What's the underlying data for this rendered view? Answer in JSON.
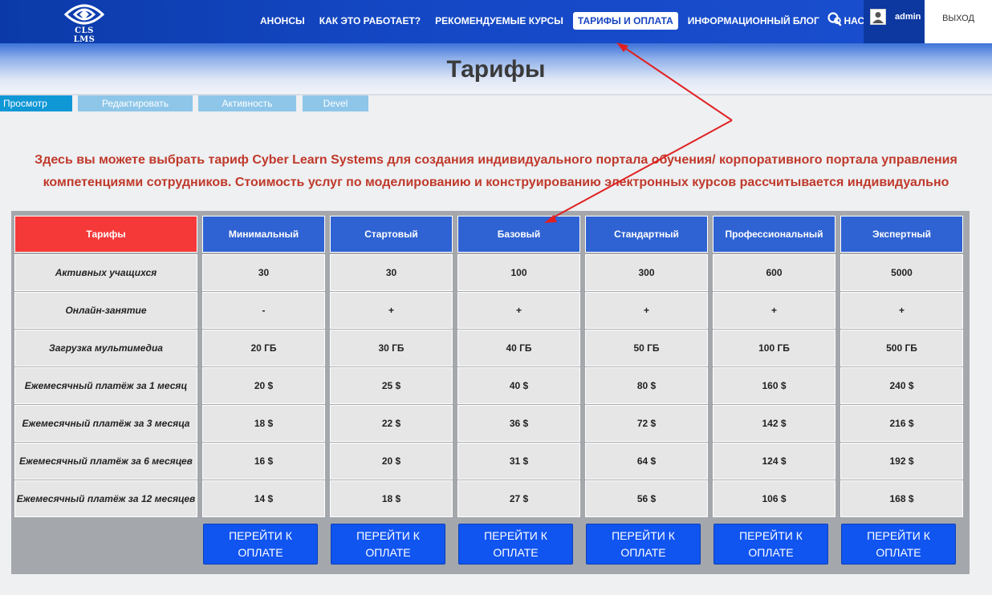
{
  "brand": {
    "logo_text": "CLS LMS"
  },
  "nav": {
    "items": [
      {
        "label": "АНОНСЫ"
      },
      {
        "label": "КАК ЭТО РАБОТАЕТ?"
      },
      {
        "label": "РЕКОМЕНДУЕМЫЕ КУРСЫ"
      },
      {
        "label": "ТАРИФЫ И ОПЛАТА",
        "active": true
      },
      {
        "label": "ИНФОРМАЦИОННЫЙ БЛОГ"
      },
      {
        "label": "О НАС"
      }
    ],
    "search_icon": "search-icon"
  },
  "user": {
    "name": "admin",
    "avatar_icon": "user-icon",
    "logout_label": "ВЫХОД"
  },
  "page": {
    "title": "Тарифы"
  },
  "tabs": [
    {
      "label": "Просмотр",
      "active": true
    },
    {
      "label": "Редактировать"
    },
    {
      "label": "Активность"
    },
    {
      "label": "Devel"
    }
  ],
  "intro": {
    "line1": "Здесь вы можете выбрать тариф  Cyber Learn Systems для создания индивидуального портала обучения/ корпоративного портала управления",
    "line2": "компетенциями сотрудников. Стоимость услуг по моделированию и конструированию электронных курсов рассчитывается индивидуально"
  },
  "pricing_table": {
    "corner_label": "Тарифы",
    "plans": [
      "Минимальный",
      "Стартовый",
      "Базовый",
      "Стандартный",
      "Профессиональный",
      "Экспертный"
    ],
    "rows": [
      {
        "label": "Активных учащихся",
        "values": [
          "30",
          "30",
          "100",
          "300",
          "600",
          "5000"
        ]
      },
      {
        "label": "Онлайн-занятие",
        "values": [
          "-",
          "+",
          "+",
          "+",
          "+",
          "+"
        ]
      },
      {
        "label": "Загрузка мультимедиа",
        "values": [
          "20 ГБ",
          "30 ГБ",
          "40 ГБ",
          "50 ГБ",
          "100 ГБ",
          "500 ГБ"
        ]
      },
      {
        "label": "Ежемесячный платёж за 1 месяц",
        "values": [
          "20 $",
          "25 $",
          "40 $",
          "80 $",
          "160 $",
          "240 $"
        ]
      },
      {
        "label": "Ежемесячный платёж за 3 месяца",
        "values": [
          "18 $",
          "22 $",
          "36 $",
          "72 $",
          "142 $",
          "216 $"
        ]
      },
      {
        "label": "Ежемесячный платёж за 6 месяцев",
        "values": [
          "16 $",
          "20 $",
          "31 $",
          "64 $",
          "124 $",
          "192 $"
        ]
      },
      {
        "label": "Ежемесячный платёж за 12 месяцев",
        "values": [
          "14 $",
          "18 $",
          "27 $",
          "56 $",
          "106 $",
          "168 $"
        ]
      }
    ],
    "pay_button_label": "ПЕРЕЙТИ К ОПЛАТЕ"
  },
  "colors": {
    "nav_bg": "#1447c4",
    "header_cell": "#2f63d3",
    "corner_cell": "#f53939",
    "intro_text": "#c0392b",
    "pay_button": "#1155f0",
    "annotation_arrow": "#e02020"
  }
}
